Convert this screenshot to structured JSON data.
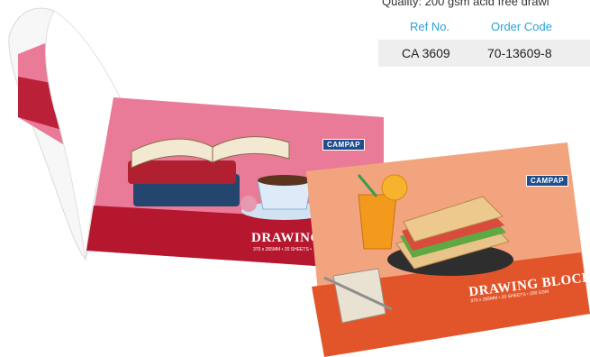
{
  "quality_line": "Quality: 200 gsm acid free drawi",
  "table": {
    "headers": [
      "Ref No.",
      "Order Code"
    ],
    "row": [
      "CA 3609",
      "70-13609-8"
    ]
  },
  "pad_back": {
    "brand": "CAMPAP",
    "title": "DRAWING B",
    "subtitle": "370 x 265MM • 20 SHEETS •"
  },
  "pad_front": {
    "brand": "CAMPAP",
    "title": "DRAWING BLOCK",
    "subtitle": "370 x 265MM • 20 SHEETS • 200 GSM"
  },
  "colors": {
    "accent_blue": "#2aa3d6",
    "pink_cover": "#e97b98",
    "red_band": "#b5172e",
    "peach_cover": "#f2a47f",
    "orange_band": "#e2552a"
  }
}
